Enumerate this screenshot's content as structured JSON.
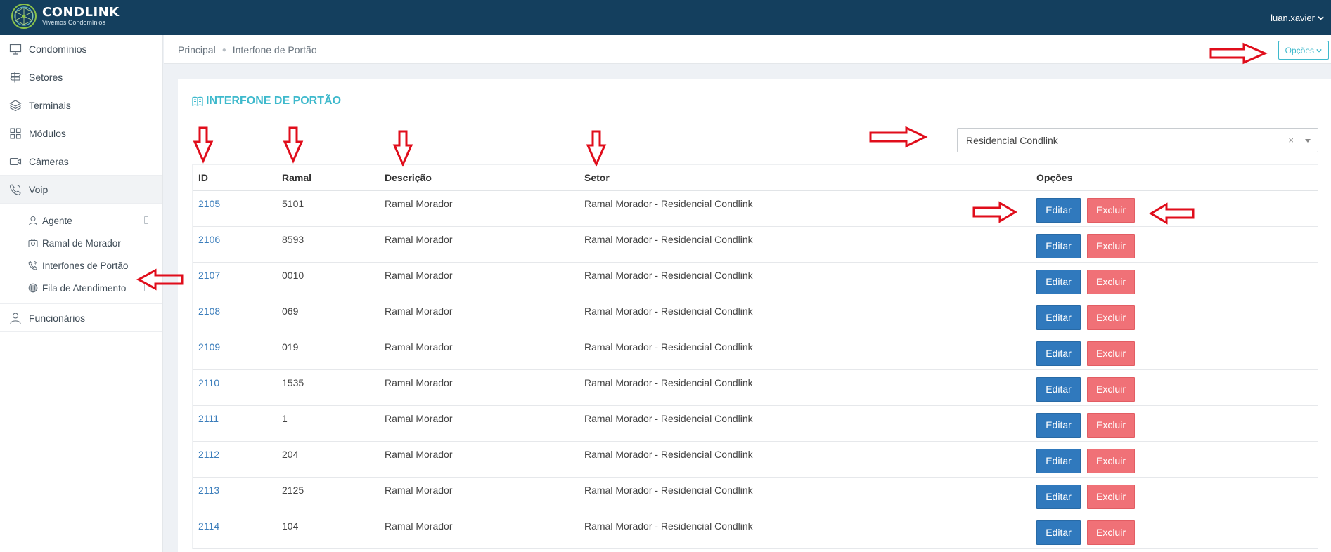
{
  "brand": {
    "name": "CONDLINK",
    "tagline": "Vivemos Condomínios",
    "primary_color": "#143f5e",
    "accent_color": "#3eb9cc"
  },
  "user": {
    "name": "luan.xavier",
    "icon": "chevron-down-icon"
  },
  "sidebar": {
    "items": [
      {
        "label": "Condomínios",
        "icon": "monitor-icon"
      },
      {
        "label": "Setores",
        "icon": "signpost-icon"
      },
      {
        "label": "Terminais",
        "icon": "layers-icon"
      },
      {
        "label": "Módulos",
        "icon": "grid-icon"
      },
      {
        "label": "Câmeras",
        "icon": "video-camera-icon"
      },
      {
        "label": "Voip",
        "icon": "phone-icon"
      }
    ],
    "voip_subitems": [
      {
        "label": "Agente",
        "icon": "user-icon"
      },
      {
        "label": "Ramal de Morador",
        "icon": "camera-icon"
      },
      {
        "label": "Interfones de Portão",
        "icon": "phone-call-icon"
      },
      {
        "label": "Fila de Atendimento",
        "icon": "globe-icon"
      }
    ],
    "bottom_item": {
      "label": "Funcionários",
      "icon": "user-icon"
    }
  },
  "breadcrumb": {
    "home": "Principal",
    "current": "Interfone de Portão"
  },
  "header": {
    "options_label": "Opções"
  },
  "panel": {
    "title": "INTERFONE DE PORTÃO",
    "title_icon": "book-icon",
    "filter": {
      "selected": "Residencial Condlink",
      "clear": "×"
    }
  },
  "table": {
    "columns": {
      "id": "ID",
      "ramal": "Ramal",
      "descricao": "Descrição",
      "setor": "Setor",
      "opcoes": "Opções"
    },
    "edit_label": "Editar",
    "delete_label": "Excluir",
    "rows": [
      {
        "id": "2105",
        "ramal": "5101",
        "descricao": "Ramal Morador",
        "setor": "Ramal Morador - Residencial Condlink"
      },
      {
        "id": "2106",
        "ramal": "8593",
        "descricao": "Ramal Morador",
        "setor": "Ramal Morador - Residencial Condlink"
      },
      {
        "id": "2107",
        "ramal": "0010",
        "descricao": "Ramal Morador",
        "setor": "Ramal Morador - Residencial Condlink"
      },
      {
        "id": "2108",
        "ramal": "069",
        "descricao": "Ramal Morador",
        "setor": "Ramal Morador - Residencial Condlink"
      },
      {
        "id": "2109",
        "ramal": "019",
        "descricao": "Ramal Morador",
        "setor": "Ramal Morador - Residencial Condlink"
      },
      {
        "id": "2110",
        "ramal": "1535",
        "descricao": "Ramal Morador",
        "setor": "Ramal Morador - Residencial Condlink"
      },
      {
        "id": "2111",
        "ramal": "1",
        "descricao": "Ramal Morador",
        "setor": "Ramal Morador - Residencial Condlink"
      },
      {
        "id": "2112",
        "ramal": "204",
        "descricao": "Ramal Morador",
        "setor": "Ramal Morador - Residencial Condlink"
      },
      {
        "id": "2113",
        "ramal": "2125",
        "descricao": "Ramal Morador",
        "setor": "Ramal Morador - Residencial Condlink"
      },
      {
        "id": "2114",
        "ramal": "104",
        "descricao": "Ramal Morador",
        "setor": "Ramal Morador - Residencial Condlink"
      }
    ]
  },
  "annotations": {
    "arrow_color": "#e00d1b"
  }
}
